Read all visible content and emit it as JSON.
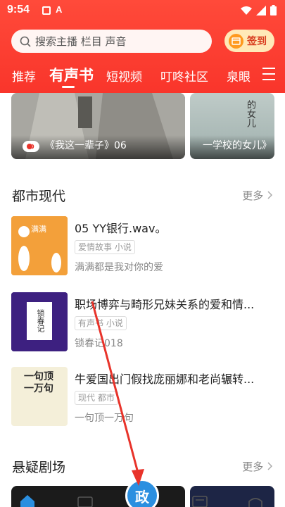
{
  "status": {
    "time": "9:54",
    "a_icon": "A"
  },
  "search": {
    "placeholder": "搜索主播 栏目 声音"
  },
  "checkin": {
    "label": "签到"
  },
  "tabs": [
    {
      "label": "推荐"
    },
    {
      "label": "有声书"
    },
    {
      "label": "短视频"
    },
    {
      "label": "叮咚社区"
    },
    {
      "label": "泉眼"
    }
  ],
  "banner": {
    "main_title": "《我这一辈子》06",
    "side_title": "一学校的女儿》",
    "side_art": "的女儿"
  },
  "section1": {
    "title": "都市现代",
    "more": "更多",
    "items": [
      {
        "title": "05 YY银行.wav。",
        "tag": "爱情故事 小说",
        "sub": "满满都是我对你的爱",
        "cover_text": "满满"
      },
      {
        "title": "职场博弈与畸形兄妹关系的爱和情...",
        "tag": "有声书 小说",
        "sub": "锁春记018",
        "cover_text": "锁春记"
      },
      {
        "title": "牛爱国出门假找庞丽娜和老尚辗转...",
        "tag": "现代 都市",
        "sub": "一句顶一万句",
        "cover_text": "一句顶一万句"
      }
    ]
  },
  "section2": {
    "title": "悬疑剧场",
    "more": "更多"
  },
  "fab": {
    "label": "政"
  },
  "colors": {
    "brand": "#f9352b",
    "fab": "#2b8fe0",
    "arrow": "#e8332a"
  }
}
